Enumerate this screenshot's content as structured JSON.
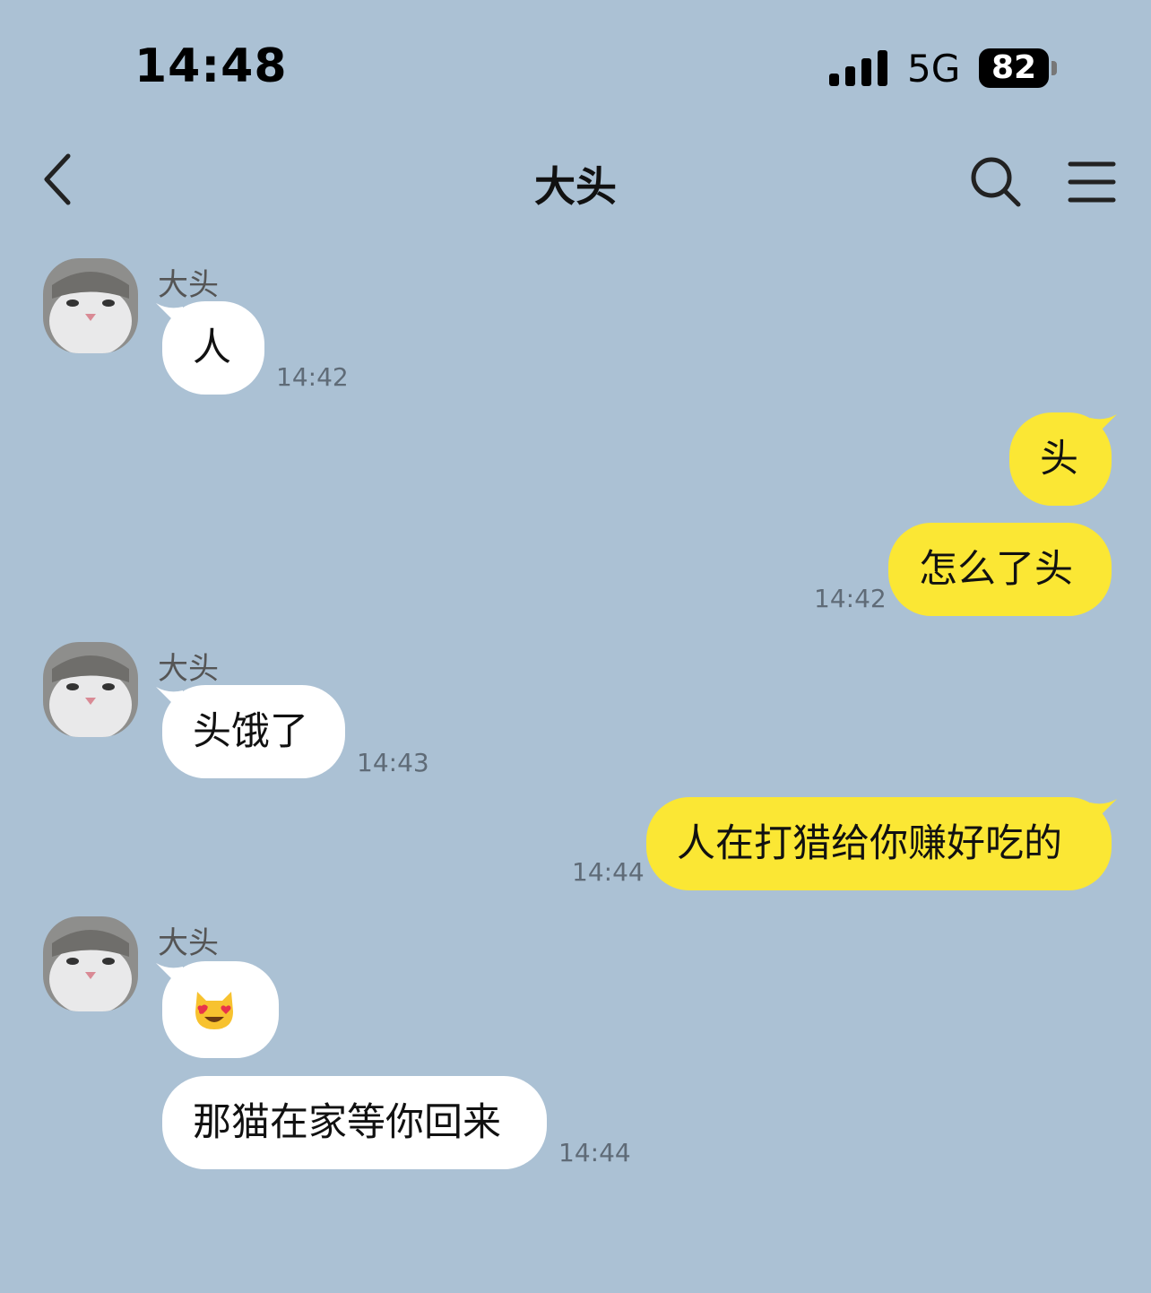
{
  "status_bar": {
    "time": "14:48",
    "network": "5G",
    "battery": "82"
  },
  "header": {
    "title": "大头"
  },
  "icons": {
    "back": "chevron-left-icon",
    "search": "search-icon",
    "menu": "hamburger-menu-icon",
    "emoji": "smiling-cat-heart-eyes-icon"
  },
  "colors": {
    "background": "#abc1d4",
    "incoming": "#ffffff",
    "outgoing": "#fbe734"
  },
  "messages": [
    {
      "direction": "in",
      "sender": "大头",
      "text": "人",
      "time": "14:42"
    },
    {
      "direction": "out",
      "text": "头",
      "time": ""
    },
    {
      "direction": "out",
      "text": "怎么了头",
      "time": "14:42"
    },
    {
      "direction": "in",
      "sender": "大头",
      "text": "头饿了",
      "time": "14:43"
    },
    {
      "direction": "out",
      "text": "人在打猎给你赚好吃的",
      "time": "14:44"
    },
    {
      "direction": "in",
      "sender": "大头",
      "text": "😻",
      "time": ""
    },
    {
      "direction": "in",
      "text": "那猫在家等你回来",
      "time": "14:44"
    }
  ]
}
